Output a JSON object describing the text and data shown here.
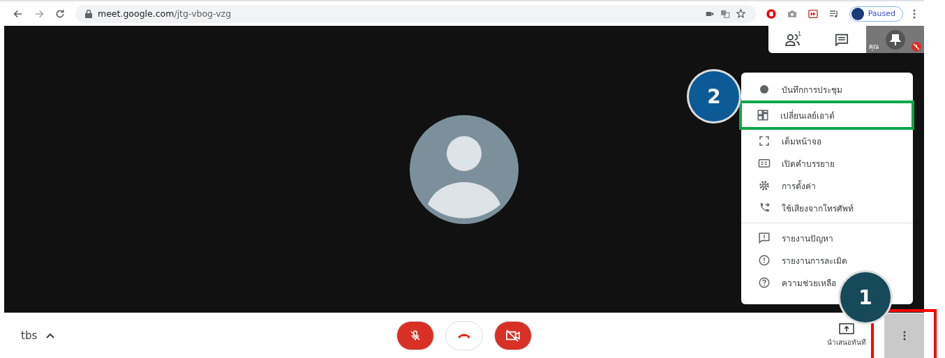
{
  "browser": {
    "url_host": "meet.google.com",
    "url_path": "/jtg-vbog-vzg",
    "profile_status": "Paused"
  },
  "top_panel": {
    "participant_count": "1",
    "self_label": "คุณ",
    "self_muted": true
  },
  "menu": {
    "sections": [
      [
        {
          "kind": "record",
          "label": "บันทึกการประชุม",
          "highlighted": false
        },
        {
          "kind": "layout",
          "label": "เปลี่ยนเลย์เอาต์",
          "highlighted": true
        },
        {
          "kind": "fullscreen",
          "label": "เต็มหน้าจอ",
          "highlighted": false
        },
        {
          "kind": "captions",
          "label": "เปิดคำบรรยาย",
          "highlighted": false
        },
        {
          "kind": "settings",
          "label": "การตั้งค่า",
          "highlighted": false
        },
        {
          "kind": "phone",
          "label": "ใช้เสียงจากโทรศัพท์",
          "highlighted": false
        }
      ],
      [
        {
          "kind": "feedback",
          "label": "รายงานปัญหา",
          "highlighted": false
        },
        {
          "kind": "abuse",
          "label": "รายงานการละเมิด",
          "highlighted": false
        },
        {
          "kind": "help",
          "label": "ความช่วยเหลือ",
          "highlighted": false
        }
      ]
    ]
  },
  "callouts": [
    {
      "label": "2",
      "color": "#0c5a96"
    },
    {
      "label": "1",
      "color": "#16495a"
    }
  ],
  "bottom_bar": {
    "meeting_name": "tbs",
    "mic_muted": true,
    "camera_off": true,
    "present_label": "นำเสนอทันที",
    "more_highlighted": true
  }
}
